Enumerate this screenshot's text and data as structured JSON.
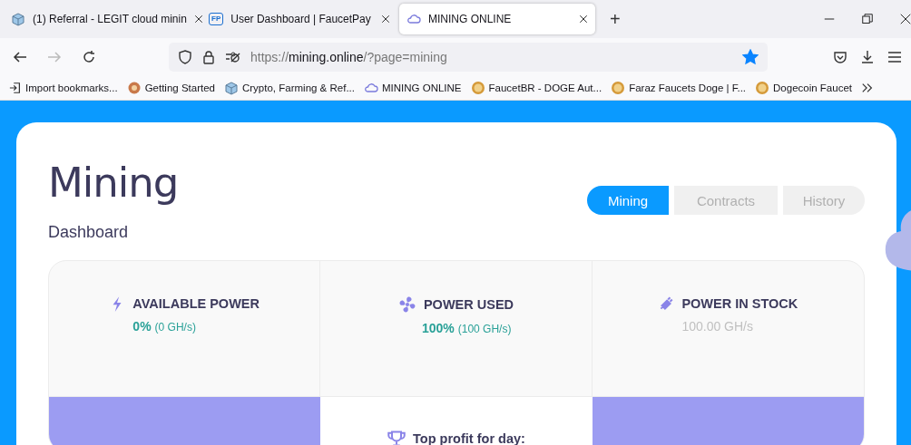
{
  "browser": {
    "tabs": [
      {
        "title": "(1) Referral - LEGIT cloud minin",
        "selected": false
      },
      {
        "title": "User Dashboard | FaucetPay",
        "selected": false
      },
      {
        "title": "MINING ONLINE",
        "selected": true
      }
    ],
    "fp_badge": "FP",
    "new_tab": "+",
    "address": {
      "scheme": "https://",
      "host": "mining.online",
      "path": "/?page=mining",
      "bookmarked": true
    },
    "bookmarks": [
      {
        "label": "Import bookmarks..."
      },
      {
        "label": "Getting Started"
      },
      {
        "label": "Crypto, Farming & Ref..."
      },
      {
        "label": "MINING ONLINE"
      },
      {
        "label": "FaucetBR - DOGE Aut..."
      },
      {
        "label": "Faraz Faucets Doge | F..."
      },
      {
        "label": "Dogecoin Faucet"
      }
    ]
  },
  "page": {
    "title": "Mining",
    "subtitle": "Dashboard",
    "tabs": [
      {
        "label": "Mining",
        "selected": true
      },
      {
        "label": "Contracts",
        "selected": false
      },
      {
        "label": "History",
        "selected": false
      }
    ],
    "stats": [
      {
        "label": "AVAILABLE POWER",
        "kind": "ratio",
        "value": "0%",
        "detail": "(0 GH/s)"
      },
      {
        "label": "POWER USED",
        "kind": "ratio",
        "value": "100%",
        "detail": "(100 GH/s)"
      },
      {
        "label": "POWER IN STOCK",
        "kind": "total",
        "value": "100.00 GH/s"
      }
    ],
    "lower_cells": [
      {
        "kind": "banner"
      },
      {
        "kind": "info",
        "label": "Top profit for day:"
      },
      {
        "kind": "banner"
      }
    ]
  }
}
